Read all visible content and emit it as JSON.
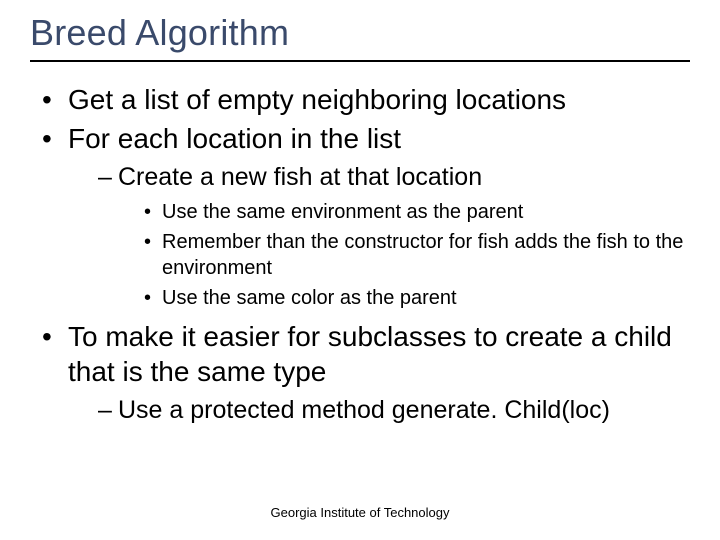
{
  "title": "Breed Algorithm",
  "bullets": {
    "b1": "Get a list of empty neighboring locations",
    "b2": "For each location in the list",
    "b2_1": "Create a new fish at that location",
    "b2_1_1": "Use the same environment as the parent",
    "b2_1_2": "Remember than the constructor for fish adds the fish to the environment",
    "b2_1_3": "Use the same color as the parent",
    "b3": "To make it easier for subclasses to create a child that is the same type",
    "b3_1": "Use a protected method generate. Child(loc)"
  },
  "footer": "Georgia Institute of Technology"
}
